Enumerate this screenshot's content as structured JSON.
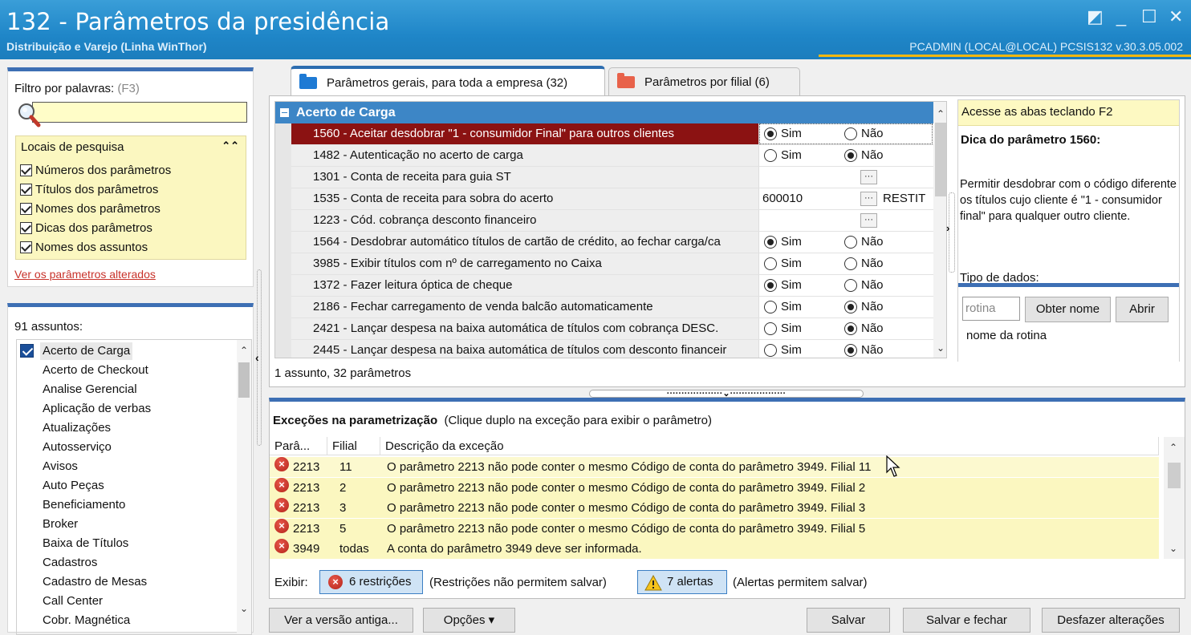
{
  "window": {
    "title": "132 - Parâmetros da presidência",
    "subtitle": "Distribuição e Varejo (Linha WinThor)",
    "session": "PCADMIN (LOCAL@LOCAL)   PCSIS132  v.30.3.05.002"
  },
  "filter": {
    "label": "Filtro por palavras:",
    "shortcut": "(F3)",
    "search_value": "",
    "locais_title": "Locais de pesquisa",
    "locais": [
      "Números dos parâmetros",
      "Títulos dos parâmetros",
      "Nomes dos parâmetros",
      "Dicas dos parâmetros",
      "Nomes dos assuntos"
    ],
    "changed_link": "Ver os parâmetros alterados"
  },
  "subjects": {
    "count_label": "91 assuntos:",
    "items": [
      "Acerto de Carga",
      "Acerto de Checkout",
      "Analise Gerencial",
      "Aplicação de verbas",
      "Atualizações",
      "Autosserviço",
      "Avisos",
      "Auto Peças",
      "Beneficiamento",
      "Broker",
      "Baixa de Títulos",
      "Cadastros",
      "Cadastro de Mesas",
      "Call Center",
      "Cobr. Magnética"
    ]
  },
  "tabs": [
    {
      "label": "Parâmetros gerais, para toda a empresa  (32)",
      "color": "#1e7ad4"
    },
    {
      "label": "Parâmetros por filial  (6)",
      "color": "#e8624a"
    }
  ],
  "grid": {
    "group": "Acerto de Carga",
    "sim": "Sim",
    "nao": "Não",
    "rows": [
      {
        "name": "1560 - Aceitar desdobrar \"1 - consumidor Final\" para outros clientes",
        "type": "radio",
        "value": "sim"
      },
      {
        "name": "1482 - Autenticação no acerto de carga",
        "type": "radio",
        "value": "nao"
      },
      {
        "name": "1301 - Conta de receita para guia ST",
        "type": "lookup",
        "value": "",
        "extra": ""
      },
      {
        "name": "1535 - Conta de receita para sobra do acerto",
        "type": "lookup",
        "value": "600010",
        "extra": "RESTIT"
      },
      {
        "name": "1223 - Cód. cobrança desconto financeiro",
        "type": "lookup",
        "value": "",
        "extra": ""
      },
      {
        "name": "1564 - Desdobrar automático títulos de cartão de crédito, ao fechar carga/ca",
        "type": "radio",
        "value": "sim"
      },
      {
        "name": "3985 - Exibir títulos com nº de carregamento no Caixa",
        "type": "radio",
        "value": "none"
      },
      {
        "name": "1372 - Fazer leitura óptica de cheque",
        "type": "radio",
        "value": "sim"
      },
      {
        "name": "2186 - Fechar carregamento de venda balcão automaticamente",
        "type": "radio",
        "value": "nao"
      },
      {
        "name": "2421 - Lançar despesa na baixa automática de títulos com cobrança DESC.",
        "type": "radio",
        "value": "nao"
      },
      {
        "name": "2445 - Lançar despesa na baixa automática de títulos com desconto financeir",
        "type": "radio",
        "value": "nao"
      }
    ],
    "footer": "1 assunto, 32 parâmetros"
  },
  "tip": {
    "bar": "Acesse as abas teclando F2",
    "title": "Dica do parâmetro 1560:",
    "text": "Permitir desdobrar com o código diferente os títulos cujo cliente é \"1 - consumidor final\" para qualquer outro cliente.",
    "tipo": "Tipo de dados:",
    "rotina_placeholder": "rotina",
    "obter_label": "Obter nome",
    "abrir_label": "Abrir",
    "nome_label": "nome da rotina"
  },
  "exceptions": {
    "title_bold": "Exceções na parametrização",
    "title_hint": "(Clique duplo na exceção para exibir o parâmetro)",
    "columns": [
      "Parâ...",
      "Filial",
      "Descrição da exceção"
    ],
    "rows": [
      {
        "param": "2213",
        "filial": "11",
        "desc": "O parâmetro 2213 não pode conter o mesmo Código de conta do parâmetro 3949. Filial 11"
      },
      {
        "param": "2213",
        "filial": "2",
        "desc": "O parâmetro 2213 não pode conter o mesmo Código de conta do parâmetro 3949. Filial 2"
      },
      {
        "param": "2213",
        "filial": "3",
        "desc": "O parâmetro 2213 não pode conter o mesmo Código de conta do parâmetro 3949. Filial 3"
      },
      {
        "param": "2213",
        "filial": "5",
        "desc": "O parâmetro 2213 não pode conter o mesmo Código de conta do parâmetro 3949. Filial 5"
      },
      {
        "param": "3949",
        "filial": "todas",
        "desc": "A conta do parâmetro 3949 deve ser informada."
      }
    ],
    "exibir": "Exibir:",
    "restricoes": "6 restrições",
    "restricoes_note": "(Restrições não permitem salvar)",
    "alertas": "7 alertas",
    "alertas_note": "(Alertas permitem salvar)"
  },
  "buttons": {
    "old_version": "Ver a versão antiga...",
    "options": "Opções ▾",
    "save": "Salvar",
    "save_close": "Salvar e fechar",
    "undo": "Desfazer alterações"
  }
}
